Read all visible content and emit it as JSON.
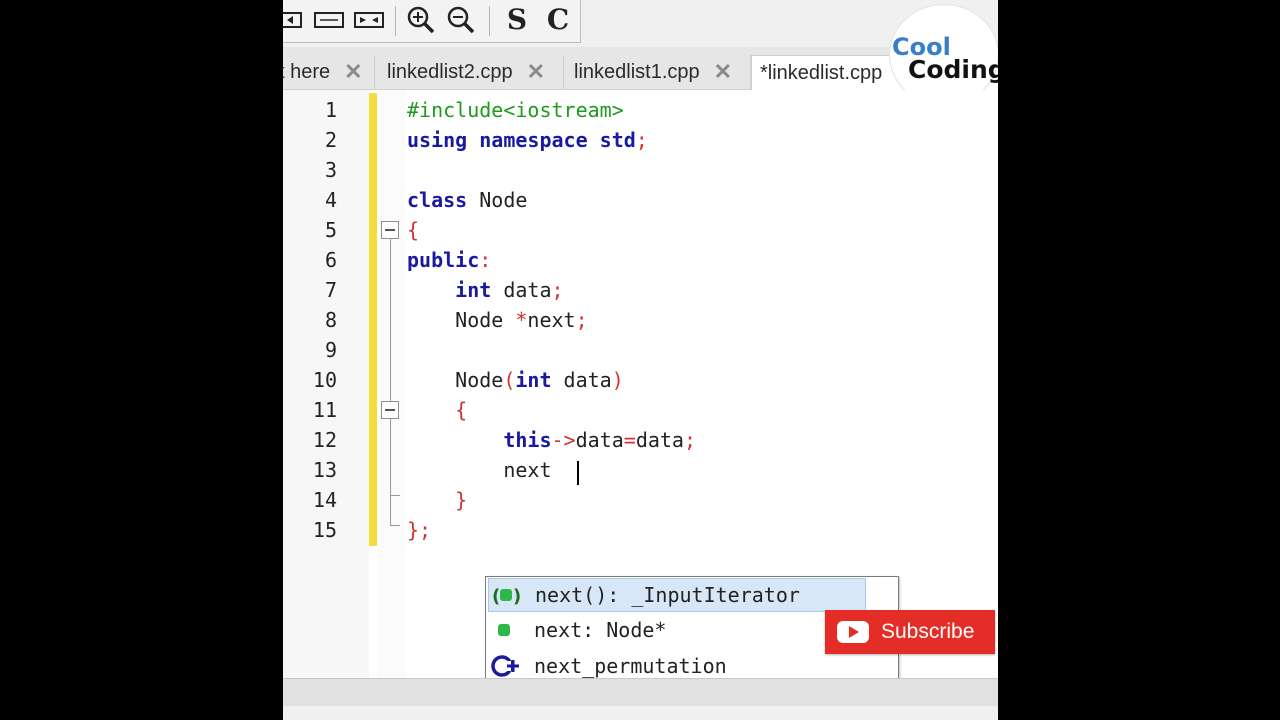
{
  "toolbar": {
    "letters": [
      "S",
      "C"
    ],
    "icons": [
      "frame-left-icon",
      "frame-rect-icon",
      "frame-right-icon",
      "zoom-in-icon",
      "zoom-out-icon"
    ]
  },
  "tabs": [
    {
      "label": "t here",
      "close": "✕"
    },
    {
      "label": "linkedlist2.cpp",
      "close": "✕"
    },
    {
      "label": "linkedlist1.cpp",
      "close": "✕"
    },
    {
      "label": "*linkedlist.cpp",
      "active": true
    }
  ],
  "logo": {
    "line1": "Cool",
    "line2": "Coding"
  },
  "line_numbers": [
    "1",
    "2",
    "3",
    "4",
    "5",
    "6",
    "7",
    "8",
    "9",
    "10",
    "11",
    "12",
    "13",
    "14",
    "15"
  ],
  "code_lines": [
    [
      {
        "t": "#include<iostream>",
        "c": "pp"
      }
    ],
    [
      {
        "t": "using namespace std",
        "c": "kw"
      },
      {
        "t": ";",
        "c": "sym"
      }
    ],
    [],
    [
      {
        "t": "class",
        "c": "kw"
      },
      {
        "t": " Node",
        "c": ""
      }
    ],
    [
      {
        "t": "{",
        "c": "sym"
      }
    ],
    [
      {
        "t": "public",
        "c": "kw"
      },
      {
        "t": ":",
        "c": "sym"
      }
    ],
    [
      {
        "t": "    ",
        "c": ""
      },
      {
        "t": "int",
        "c": "kw"
      },
      {
        "t": " data",
        "c": ""
      },
      {
        "t": ";",
        "c": "sym"
      }
    ],
    [
      {
        "t": "    Node ",
        "c": ""
      },
      {
        "t": "*",
        "c": "sym"
      },
      {
        "t": "next",
        "c": ""
      },
      {
        "t": ";",
        "c": "sym"
      }
    ],
    [],
    [
      {
        "t": "    Node",
        "c": ""
      },
      {
        "t": "(",
        "c": "sym"
      },
      {
        "t": "int",
        "c": "kw"
      },
      {
        "t": " data",
        "c": ""
      },
      {
        "t": ")",
        "c": "sym"
      }
    ],
    [
      {
        "t": "    ",
        "c": ""
      },
      {
        "t": "{",
        "c": "sym"
      }
    ],
    [
      {
        "t": "        ",
        "c": ""
      },
      {
        "t": "this",
        "c": "kw"
      },
      {
        "t": "->",
        "c": "sym"
      },
      {
        "t": "data",
        "c": ""
      },
      {
        "t": "=",
        "c": "sym"
      },
      {
        "t": "data",
        "c": ""
      },
      {
        "t": ";",
        "c": "sym"
      }
    ],
    [
      {
        "t": "        next",
        "c": ""
      }
    ],
    [
      {
        "t": "    ",
        "c": ""
      },
      {
        "t": "}",
        "c": "sym"
      }
    ],
    [
      {
        "t": "}",
        "c": "sym"
      },
      {
        "t": ";",
        "c": "sym"
      }
    ]
  ],
  "autocomplete": {
    "items": [
      {
        "label": "next(): _InputIterator",
        "icon": "method-icon",
        "selected": true
      },
      {
        "label": "next: Node*",
        "icon": "member-icon"
      },
      {
        "label": "next_permutation",
        "icon": "function-template-icon"
      }
    ]
  },
  "subscribe": {
    "label": "Subscribe"
  },
  "colors": {
    "keyword": "#1a1aa0",
    "preprocessor": "#1e9b1e",
    "symbol": "#d23232",
    "change_bar": "#f4dc3c",
    "subscribe": "#e52d27"
  }
}
